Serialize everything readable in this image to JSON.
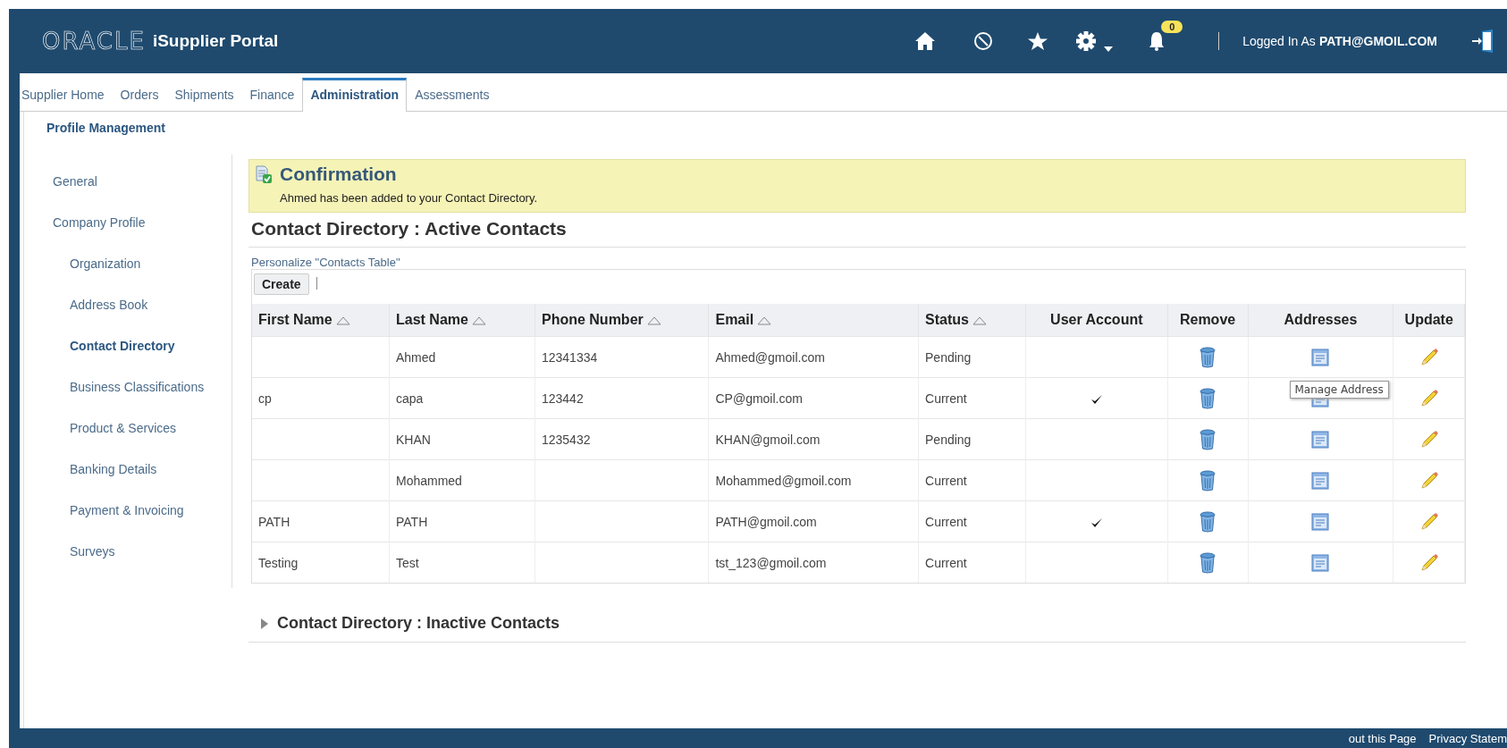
{
  "header": {
    "logo": "ORACLE",
    "product": "iSupplier Portal",
    "notification_count": "0",
    "user_label": "Logged In As",
    "user": "PATH@GMOIL.COM"
  },
  "tabs": [
    {
      "label": "Supplier Home",
      "selected": false
    },
    {
      "label": "Orders",
      "selected": false
    },
    {
      "label": "Shipments",
      "selected": false
    },
    {
      "label": "Finance",
      "selected": false
    },
    {
      "label": "Administration",
      "selected": true
    },
    {
      "label": "Assessments",
      "selected": false
    }
  ],
  "subtab": "Profile Management",
  "sidebar": {
    "items": [
      {
        "label": "General",
        "selected": false
      },
      {
        "label": "Company Profile",
        "selected": false,
        "children": [
          {
            "label": "Organization",
            "selected": false
          },
          {
            "label": "Address Book",
            "selected": false
          },
          {
            "label": "Contact Directory",
            "selected": true
          },
          {
            "label": "Business Classifications",
            "selected": false
          },
          {
            "label": "Product & Services",
            "selected": false
          },
          {
            "label": "Banking Details",
            "selected": false
          },
          {
            "label": "Payment & Invoicing",
            "selected": false
          },
          {
            "label": "Surveys",
            "selected": false
          }
        ]
      }
    ]
  },
  "confirmation": {
    "title": "Confirmation",
    "message": "Ahmed has been added to your Contact Directory."
  },
  "active_section": {
    "title": "Contact Directory : Active Contacts",
    "personalize_link": "Personalize \"Contacts Table\"",
    "create_button": "Create"
  },
  "table": {
    "columns": [
      {
        "label": "First Name",
        "sortable": true
      },
      {
        "label": "Last Name",
        "sortable": true
      },
      {
        "label": "Phone Number",
        "sortable": true
      },
      {
        "label": "Email",
        "sortable": true
      },
      {
        "label": "Status",
        "sortable": true
      },
      {
        "label": "User Account",
        "sortable": false
      },
      {
        "label": "Remove",
        "sortable": false
      },
      {
        "label": "Addresses",
        "sortable": false
      },
      {
        "label": "Update",
        "sortable": false
      }
    ],
    "rows": [
      {
        "first_name": "",
        "last_name": "Ahmed",
        "phone": "12341334",
        "email": "Ahmed@gmoil.com",
        "status": "Pending",
        "user_account": false
      },
      {
        "first_name": "cp",
        "last_name": "capa",
        "phone": "123442",
        "email": "CP@gmoil.com",
        "status": "Current",
        "user_account": true,
        "tooltip": "Manage Address"
      },
      {
        "first_name": "",
        "last_name": "KHAN",
        "phone": "1235432",
        "email": "KHAN@gmoil.com",
        "status": "Pending",
        "user_account": false
      },
      {
        "first_name": "",
        "last_name": "Mohammed",
        "phone": "",
        "email": "Mohammed@gmoil.com",
        "status": "Current",
        "user_account": false
      },
      {
        "first_name": "PATH",
        "last_name": "PATH",
        "phone": "",
        "email": "PATH@gmoil.com",
        "status": "Current",
        "user_account": true
      },
      {
        "first_name": "Testing",
        "last_name": "Test",
        "phone": "",
        "email": "tst_123@gmoil.com",
        "status": "Current",
        "user_account": false
      }
    ]
  },
  "inactive_section": {
    "title": "Contact Directory : Inactive Contacts",
    "expanded": false
  },
  "footer": {
    "links": [
      "out this Page",
      "Privacy Statem"
    ]
  }
}
